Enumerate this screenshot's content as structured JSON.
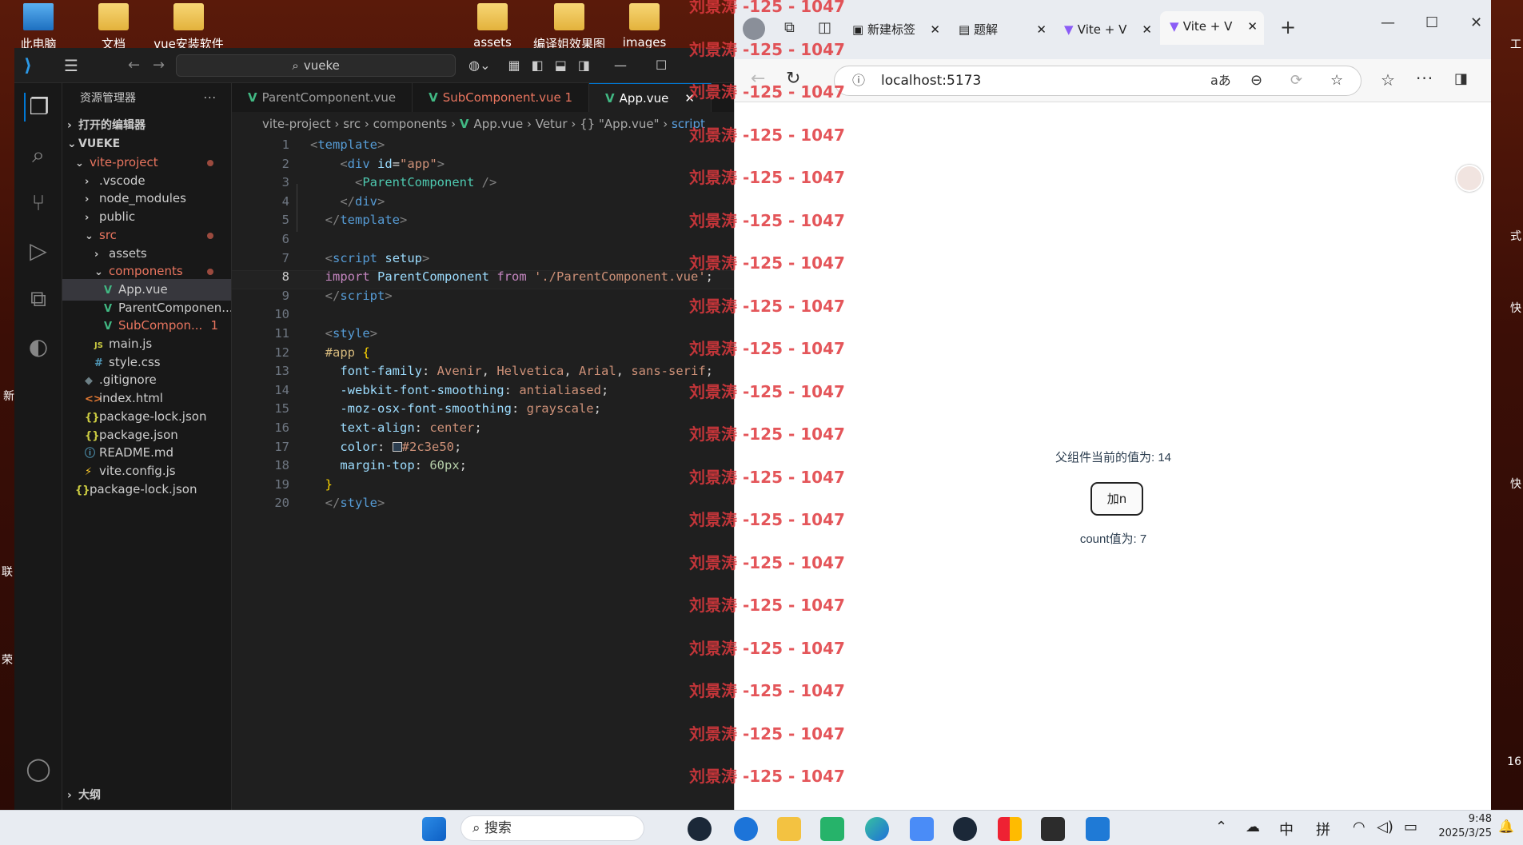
{
  "desktop": {
    "icons": [
      "此电脑",
      "文档",
      "vue安装软件",
      "assets",
      "编译姐效果图",
      "images"
    ],
    "right_edge": [
      "工",
      "式",
      "快",
      "快",
      "16"
    ],
    "left_edge": [
      "新",
      "联",
      "荣"
    ]
  },
  "vscode": {
    "search": "vueke",
    "explorer_title": "资源管理器",
    "open_editors": "打开的编辑器",
    "project": "VUEKE",
    "tree": [
      {
        "label": "vite-project",
        "dot": true,
        "type": "folder-open",
        "level": 0,
        "color": "#e9755f"
      },
      {
        "label": ".vscode",
        "type": "folder",
        "level": 1
      },
      {
        "label": "node_modules",
        "type": "folder",
        "level": 1
      },
      {
        "label": "public",
        "type": "folder",
        "level": 1
      },
      {
        "label": "src",
        "dot": true,
        "type": "folder-open",
        "level": 1,
        "color": "#e9755f"
      },
      {
        "label": "assets",
        "type": "folder",
        "level": 2
      },
      {
        "label": "components",
        "dot": true,
        "type": "folder-open",
        "level": 2,
        "color": "#e9755f"
      },
      {
        "label": "App.vue",
        "type": "vue",
        "level": 3,
        "selected": true
      },
      {
        "label": "ParentComponen...",
        "type": "vue",
        "level": 3
      },
      {
        "label": "SubCompon...",
        "badge": "1",
        "type": "vue",
        "level": 3,
        "color": "#e9755f"
      },
      {
        "label": "main.js",
        "type": "js",
        "level": 2
      },
      {
        "label": "style.css",
        "type": "css",
        "level": 2
      },
      {
        "label": ".gitignore",
        "type": "git",
        "level": 1
      },
      {
        "label": "index.html",
        "type": "html",
        "level": 1
      },
      {
        "label": "package-lock.json",
        "type": "json",
        "level": 1
      },
      {
        "label": "package.json",
        "type": "json",
        "level": 1
      },
      {
        "label": "README.md",
        "type": "md",
        "level": 1
      },
      {
        "label": "vite.config.js",
        "type": "vite",
        "level": 1
      },
      {
        "label": "package-lock.json",
        "type": "json",
        "level": 0
      }
    ],
    "outline": "大纲",
    "tabs": [
      {
        "label": "ParentComponent.vue",
        "active": false
      },
      {
        "label": "SubComponent.vue",
        "badge": "1",
        "active": false,
        "color": "#e9755f"
      },
      {
        "label": "App.vue",
        "active": true
      }
    ],
    "breadcrumbs": [
      "vite-project",
      "src",
      "components",
      "App.vue",
      "Vetur",
      "{} \"App.vue\"",
      "script"
    ],
    "current_line": "8"
  },
  "browser": {
    "tabs": [
      "新建标签",
      "题解",
      "Vite + V",
      "Vite + V"
    ],
    "url": "localhost:5173",
    "parent_text": "父组件当前的值为: 14",
    "button": "加n",
    "count_text": "count值为: 7"
  },
  "watermark": "刘景涛 -125 - 1047",
  "taskbar": {
    "search": "搜索",
    "ime": [
      "中",
      "拼"
    ],
    "time": "9:48",
    "date": "2025/3/25"
  },
  "colors": {
    "accent": "#0078d4",
    "vue": "#41b883",
    "watermark": "#e0393e"
  }
}
